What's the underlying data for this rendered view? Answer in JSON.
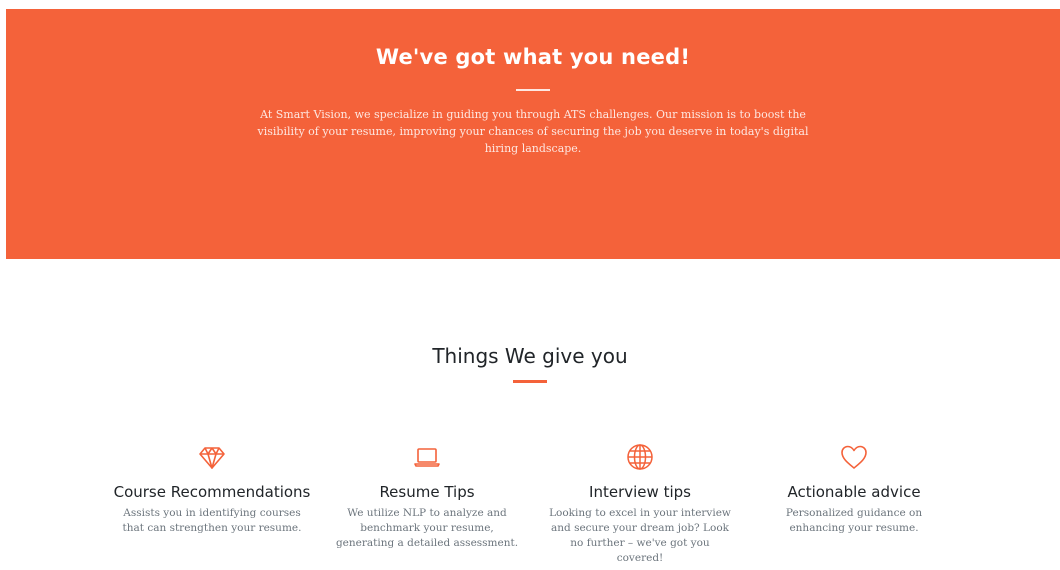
{
  "hero": {
    "title": "We've got what you need!",
    "text": "At Smart Vision, we specialize in guiding you through ATS challenges. Our mission is to boost the visibility of your resume, improving your chances of securing the job you deserve in today's digital hiring landscape."
  },
  "services": {
    "title": "Things We give you",
    "items": [
      {
        "icon": "gem-icon",
        "title": "Course Recommendations",
        "text": "Assists you in identifying courses that can strengthen your resume."
      },
      {
        "icon": "laptop-icon",
        "title": "Resume Tips",
        "text": "We utilize NLP to analyze and benchmark your resume, generating a detailed assessment."
      },
      {
        "icon": "globe-icon",
        "title": "Interview tips",
        "text": "Looking to excel in your interview and secure your dream job? Look no further – we've got you covered!"
      },
      {
        "icon": "heart-icon",
        "title": "Actionable advice",
        "text": "Personalized guidance on enhancing your resume."
      }
    ]
  },
  "colors": {
    "accent": "#f4623a",
    "heading": "#212529",
    "muted": "#6c757d"
  }
}
